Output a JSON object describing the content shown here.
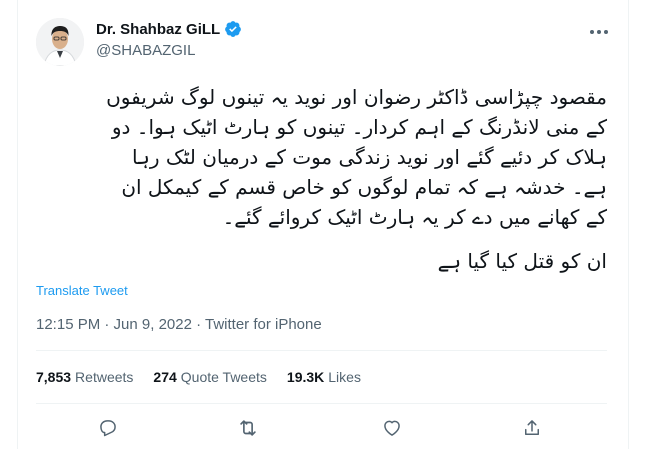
{
  "author": {
    "display_name": "Dr. Shahbaz GiLL",
    "handle": "@SHABAZGIL",
    "verified": true
  },
  "tweet": {
    "lines": [
      "مقصود چپڑاسی ڈاکٹر رضوان اور نوید یہ تینوں لوگ شریفوں",
      "کے منی لانڈرنگ کے اہم کردار۔ تینوں کو ہارٹ اٹیک ہوا۔ دو",
      "ہلاک کر دئیے گئے اور نوید زندگی موت کے درمیان لٹک رہا",
      "ہے۔ خدشہ ہے کہ تمام لوگوں کو خاص قسم کے کیمکل ان",
      "کے کھانے میں دے کر یہ ہارٹ اٹیک کروائے گئے۔"
    ],
    "closing_line": "ان کو قتل کیا گیا ہے",
    "translate_label": "Translate Tweet",
    "timestamp": "12:15 PM · Jun 9, 2022 · Twitter for iPhone"
  },
  "stats": {
    "retweets_count": "7,853",
    "retweets_label": "Retweets",
    "quotes_count": "274",
    "quotes_label": "Quote Tweets",
    "likes_count": "19.3K",
    "likes_label": "Likes"
  },
  "icons": {
    "verified": "verified-badge-icon",
    "more": "more-dots-icon",
    "reply": "reply-icon",
    "retweet": "retweet-icon",
    "like": "heart-icon",
    "share": "share-icon"
  },
  "colors": {
    "accent": "#1d9bf0",
    "text": "#0f1419",
    "secondary": "#536471",
    "border": "#eff3f4"
  }
}
